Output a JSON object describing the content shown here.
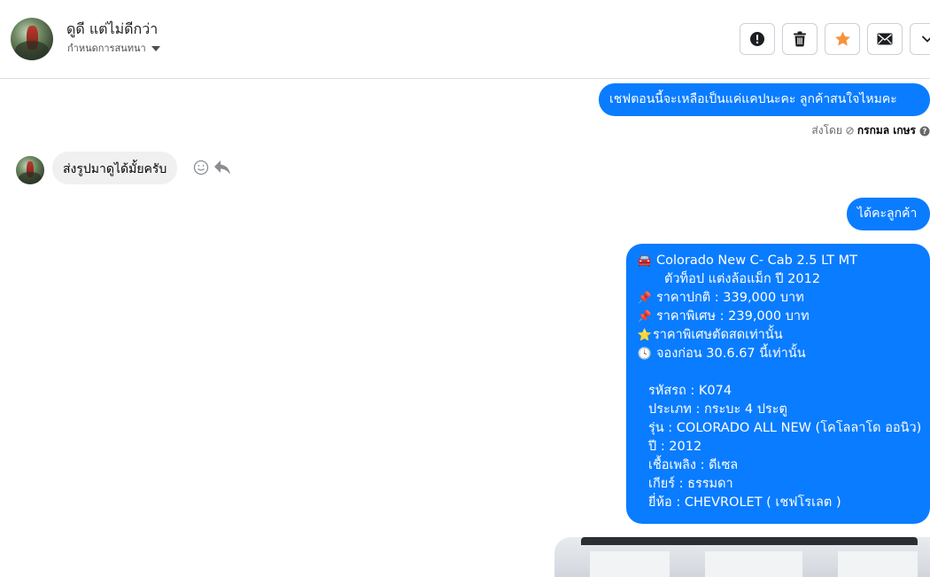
{
  "header": {
    "name": "ดูดี แต่ไม่ดีกว่า",
    "subtitle": "กำหนดการสนทนา",
    "actions": [
      {
        "icon": "alert-icon"
      },
      {
        "icon": "trash-icon"
      },
      {
        "icon": "star-icon",
        "color": "#f7923b"
      },
      {
        "icon": "mail-icon"
      },
      {
        "icon": "chevron-down-icon"
      }
    ]
  },
  "messages": {
    "out1": {
      "text": "เชฟตอนนี้จะเหลือเป็นแค่แคปนะคะ  ลูกค้าสนใจไหมคะ",
      "sent_by_label": "ส่งโดย",
      "sent_by_name": "กรกมล เกษร"
    },
    "in1": {
      "text": "ส่งรูปมาดูได้มั้ยครับ"
    },
    "out2": {
      "text": "ได้คะลูกค้า"
    },
    "out3": {
      "lines": [
        {
          "emoji": "🚘",
          "text": "Colorado New C- Cab 2.5 LT MT"
        },
        {
          "emoji": "",
          "text": "ตัวท็อป แต่งล้อแม็ก ปี 2012"
        },
        {
          "emoji": "📌",
          "text": "ราคาปกติ : 339,000 บาท"
        },
        {
          "emoji": "📌",
          "text": "ราคาพิเศษ : 239,000 บาท"
        },
        {
          "emoji": "⭐",
          "text": "ราคาพิเศษตัดสดเท่านั้น"
        },
        {
          "emoji": "🕓",
          "text": "จองก่อน 30.6.67 นี้เท่านั้น"
        },
        {
          "emoji": "",
          "text": ""
        },
        {
          "emoji": "",
          "text": "รหัสรถ : K074"
        },
        {
          "emoji": "",
          "text": "ประเภท : กระบะ 4 ประตู"
        },
        {
          "emoji": "",
          "text": "รุ่น : COLORADO ALL NEW (โคโลลาโด ออนิว)"
        },
        {
          "emoji": "",
          "text": "ปี : 2012"
        },
        {
          "emoji": "",
          "text": "เชื้อเพลิง : ดีเซล"
        },
        {
          "emoji": "",
          "text": "เกียร์ : ธรรมดา"
        },
        {
          "emoji": "",
          "text": "ยี่ห้อ : CHEVROLET ( เชฟโรเลต )"
        }
      ]
    }
  },
  "colors": {
    "accent": "#0a7cff",
    "incoming_bubble": "#f0f0f0"
  }
}
